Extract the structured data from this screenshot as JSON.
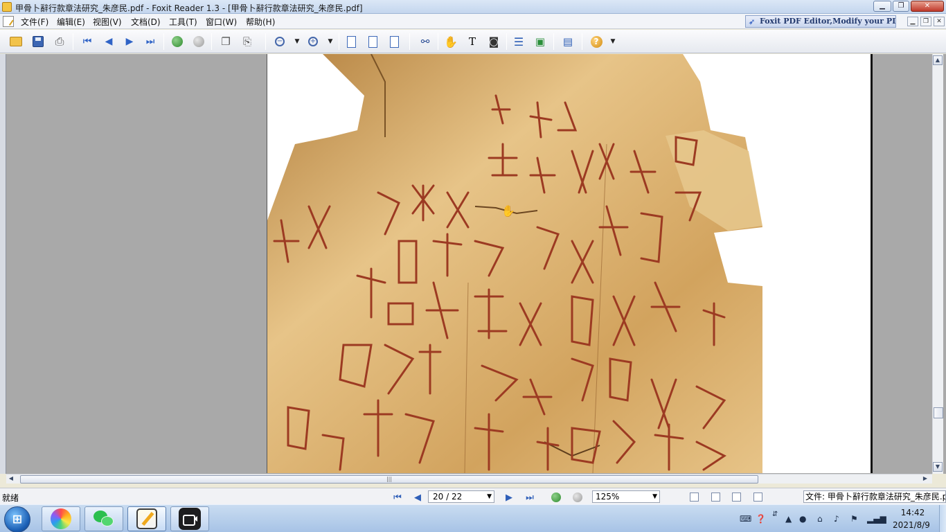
{
  "window": {
    "title": "甲骨卜辭行款章法研究_朱彦民.pdf - Foxit Reader 1.3 - [甲骨卜辭行款章法研究_朱彦民.pdf]",
    "minimize": "▁",
    "maximize": "❐",
    "close": "✕"
  },
  "menu": {
    "items": [
      "文件(F)",
      "编辑(E)",
      "视图(V)",
      "文档(D)",
      "工具(T)",
      "窗口(W)",
      "帮助(H)"
    ],
    "promo": "Foxit PDF Editor,Modify your PDF!",
    "mdi_minimize": "▁",
    "mdi_restore": "❐",
    "mdi_close": "✕"
  },
  "toolbar": {
    "icons": [
      "open-folder",
      "save-disk",
      "print",
      "first-page",
      "previous-page",
      "next-page",
      "last-page",
      "go-back",
      "go-forward",
      "copy",
      "paste",
      "zoom-out",
      "zoom-in",
      "actual-size",
      "fit-page",
      "fit-width",
      "find",
      "hand-tool",
      "text-select",
      "snapshot",
      "bookmarks-panel",
      "thumbnails",
      "properties",
      "help"
    ]
  },
  "status": {
    "ready": "就绪",
    "page_current": "20",
    "page_separator": "/",
    "page_total": "22",
    "zoom": "125%",
    "file_info": "文件: 甲骨卜辭行款章法研究_朱彦民.p"
  },
  "taskbar": {
    "start_label": "⊞",
    "apps": [
      "pinwheel-app",
      "wechat",
      "foxit-reader",
      "video-app"
    ],
    "clock_time": "14:42",
    "clock_date": "2021/8/9"
  },
  "colors": {
    "bone_light": "#e7c488",
    "bone_mid": "#d2a35e",
    "bone_dark": "#b3803e",
    "carving": "#9c3a22",
    "workspace": "#a9a9a9"
  }
}
